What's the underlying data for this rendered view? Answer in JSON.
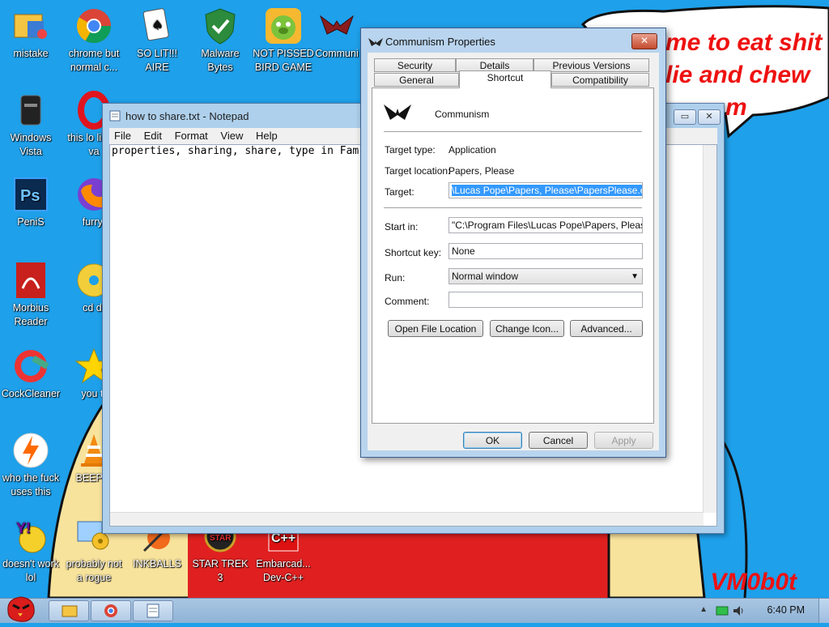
{
  "wallpaper": {
    "speech_line1": "me to eat shit",
    "speech_line2": "lie and chew",
    "speech_line3": "m",
    "signature": "VM0b0t"
  },
  "desktop_icons": [
    {
      "label": "mistake",
      "icon": "folder-icon"
    },
    {
      "label": "chrome but normal c...",
      "icon": "chrome-icon"
    },
    {
      "label": "SO LIT!!! AIRE",
      "icon": "solitaire-icon"
    },
    {
      "label": "Malware Bytes",
      "icon": "shield-icon"
    },
    {
      "label": "NOT PISSED BIRD GAME",
      "icon": "pig-icon"
    },
    {
      "label": "Communi",
      "icon": "eagle-icon"
    },
    {
      "label": "Windows Vista",
      "icon": "bin-icon"
    },
    {
      "label": "this lo like a va",
      "icon": "opera-icon"
    },
    {
      "label": "PeniS",
      "icon": "photoshop-icon"
    },
    {
      "label": "furryf",
      "icon": "firefox-icon"
    },
    {
      "label": "Morbius Reader",
      "icon": "pdf-icon"
    },
    {
      "label": "cd dr",
      "icon": "cd-icon"
    },
    {
      "label": "CockCleaner",
      "icon": "ccleaner-icon"
    },
    {
      "label": "you tr",
      "icon": "star-icon"
    },
    {
      "label": "who the fuck uses this",
      "icon": "bolt-icon"
    },
    {
      "label": "BEEP B",
      "icon": "cone-icon"
    },
    {
      "label": "doesn't work lol",
      "icon": "yahoo-icon"
    },
    {
      "label": "probably not a rogue",
      "icon": "gears-icon"
    },
    {
      "label": "INKBALLS",
      "icon": "inkball-icon"
    },
    {
      "label": "STAR TREK 3",
      "icon": "startrek-icon"
    },
    {
      "label": "Embarcad... Dev-C++",
      "icon": "devcpp-icon"
    }
  ],
  "notepad": {
    "title": "how to share.txt - Notepad",
    "menu": [
      "File",
      "Edit",
      "Format",
      "View",
      "Help"
    ],
    "content": "properties, sharing, share, type in Fam"
  },
  "dialog": {
    "title": "Communism Properties",
    "tabs_row1": [
      "Security",
      "Details",
      "Previous Versions"
    ],
    "tabs_row2": [
      "General",
      "Shortcut",
      "Compatibility"
    ],
    "active_tab": "Shortcut",
    "name": "Communism",
    "target_type_label": "Target type:",
    "target_type": "Application",
    "target_location_label": "Target location:",
    "target_location": "Papers, Please",
    "target_label": "Target:",
    "target": "\\Lucas Pope\\Papers, Please\\PapersPlease.exe\"",
    "start_in_label": "Start in:",
    "start_in": "\"C:\\Program Files\\Lucas Pope\\Papers, Please\"",
    "shortcut_key_label": "Shortcut key:",
    "shortcut_key": "None",
    "run_label": "Run:",
    "run": "Normal window",
    "comment_label": "Comment:",
    "comment": "",
    "btn_open_location": "Open File Location",
    "btn_change_icon": "Change Icon...",
    "btn_advanced": "Advanced...",
    "btn_ok": "OK",
    "btn_cancel": "Cancel",
    "btn_apply": "Apply"
  },
  "taskbar": {
    "clock": "6:40 PM"
  },
  "colors": {
    "sky": "#1ea0ea",
    "red": "#e02020",
    "sand": "#f8e39c"
  }
}
